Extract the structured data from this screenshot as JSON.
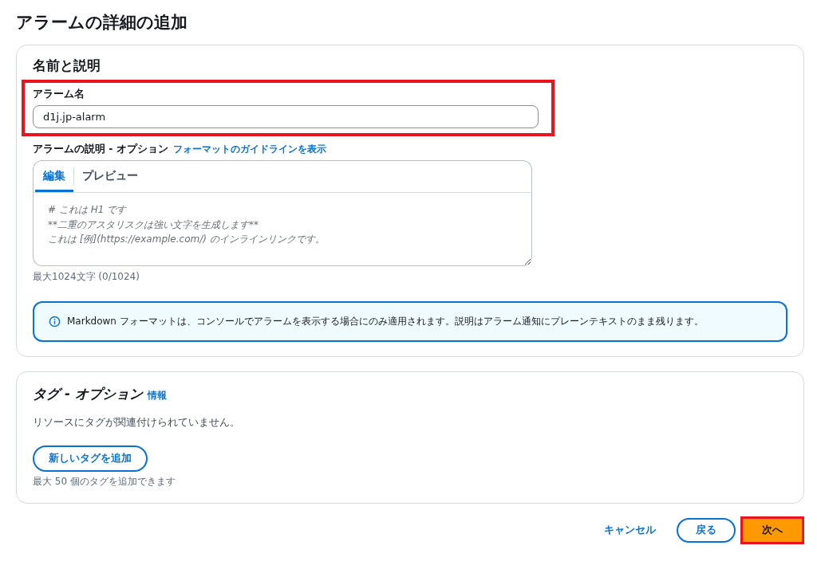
{
  "page_title": "アラームの詳細の追加",
  "name_section": {
    "title": "名前と説明",
    "alarm_name": {
      "label": "アラーム名",
      "value": "d1j.jp-alarm",
      "highlighted": true
    },
    "description": {
      "label": "アラームの説明 - オプション",
      "link": "フォーマットのガイドラインを表示",
      "tabs": [
        {
          "label": "編集",
          "selected": true
        },
        {
          "label": "プレビュー",
          "selected": false
        }
      ],
      "placeholder": "# これは H1 です\n**二重のアスタリスクは強い文字を生成します**\nこれは [例](https://example.com/) のインラインリンクです。",
      "counter": "最大1024文字 (0/1024)"
    },
    "info": "Markdown フォーマットは、コンソールでアラームを表示する場合にのみ適用されます。説明はアラーム通知にプレーンテキストのまま残ります。"
  },
  "tags_section": {
    "title": "タグ - オプション",
    "info_link": "情報",
    "empty_text": "リソースにタグが関連付けられていません。",
    "add_button": "新しいタグを追加",
    "hint": "最大 50 個のタグを追加できます"
  },
  "footer": {
    "cancel": "キャンセル",
    "back": "戻る",
    "next": {
      "label": "次へ",
      "highlighted": true
    }
  }
}
